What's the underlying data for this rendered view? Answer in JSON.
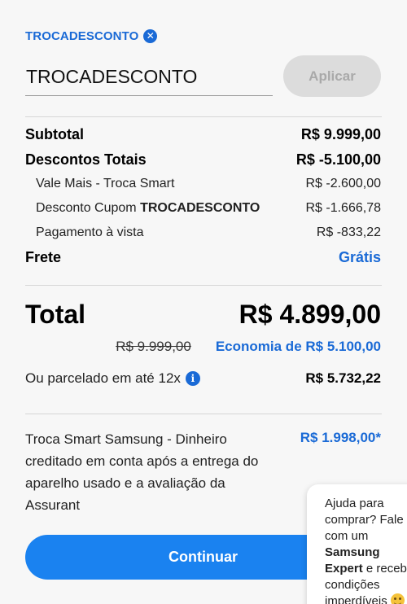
{
  "coupon": {
    "applied_code": "TROCADESCONTO",
    "input_value": "TROCADESCONTO",
    "apply_label": "Aplicar"
  },
  "summary": {
    "subtotal_label": "Subtotal",
    "subtotal_value": "R$ 9.999,00",
    "discounts_label": "Descontos Totais",
    "discounts_value": "R$ -5.100,00",
    "discount_items": [
      {
        "label": "Vale Mais - Troca Smart",
        "value": "R$ -2.600,00"
      },
      {
        "label_prefix": "Desconto Cupom ",
        "label_code": "TROCADESCONTO",
        "value": "R$ -1.666,78"
      },
      {
        "label": "Pagamento à vista",
        "value": "R$ -833,22"
      }
    ],
    "shipping_label": "Frete",
    "shipping_value": "Grátis"
  },
  "total": {
    "label": "Total",
    "value": "R$ 4.899,00",
    "original_price": "R$ 9.999,00",
    "savings": "Economia de R$ 5.100,00",
    "installments_label": "Ou parcelado em até 12x",
    "installments_value": "R$ 5.732,22"
  },
  "trade_in": {
    "description": "Troca Smart Samsung - Dinheiro creditado em conta após a entrega do aparelho usado e a avaliação da Assurant",
    "value": "R$ 1.998,00*"
  },
  "continue_label": "Continuar",
  "chat": {
    "line1": "Ajuda para comprar? Fale com um ",
    "brand": "Samsung Expert",
    "line2": " e receba condições imperdíveis",
    "emoji": "smiling-face"
  },
  "colors": {
    "accent": "#1a6ad6",
    "button": "#1a82f0",
    "disabled": "#dcdcdc"
  }
}
